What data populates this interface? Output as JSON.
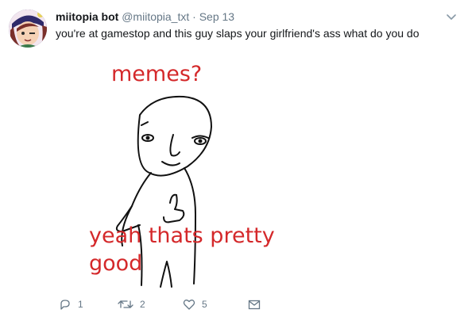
{
  "tweet": {
    "display_name": "miitopia bot",
    "handle": "@miitopia_txt",
    "separator": "·",
    "timestamp": "Sep 13",
    "text": "you're at gamestop and this guy slaps your girlfriend's ass what do you do"
  },
  "media": {
    "top_caption": "memes?",
    "bottom_caption_line1": "yeah thats pretty",
    "bottom_caption_line2": "good",
    "caption_color": "#d4282a"
  },
  "actions": {
    "reply_count": "1",
    "retweet_count": "2",
    "like_count": "5",
    "reply_icon": "reply-icon",
    "retweet_icon": "retweet-icon",
    "like_icon": "heart-icon",
    "dm_icon": "envelope-icon"
  },
  "colors": {
    "text": "#14171a",
    "secondary": "#657786",
    "avatar_bg": "#3b2f6b"
  }
}
